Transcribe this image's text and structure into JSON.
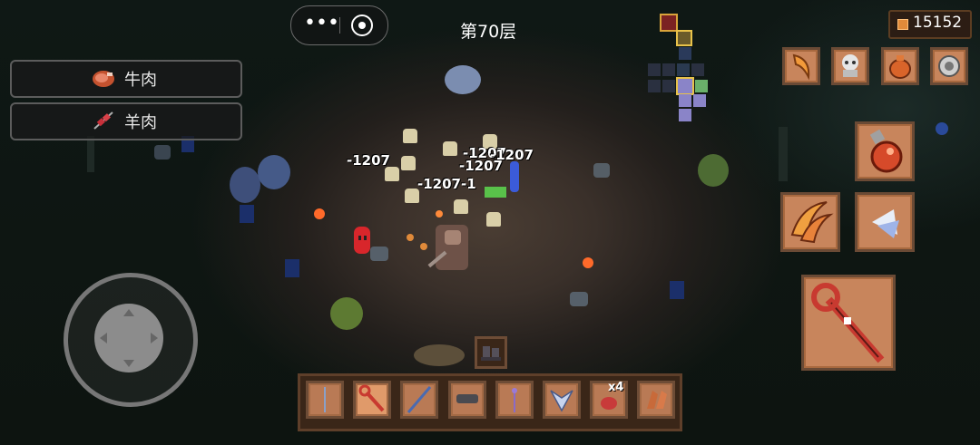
{
  "header": {
    "floor_label": "第70层",
    "coins": "15152"
  },
  "capsule": {
    "more_glyph": "•••",
    "close_glyph": "◉"
  },
  "food_list": [
    {
      "label": "牛肉",
      "icon": "steak-icon"
    },
    {
      "label": "羊肉",
      "icon": "mutton-skewer-icon"
    }
  ],
  "damage_numbers": [
    "-1207",
    "-1207",
    "-1207",
    "-1207-1",
    "-1207"
  ],
  "hotbar": {
    "bonus_badge": "x4",
    "slots": [
      "spear-icon",
      "fire-staff-icon",
      "lance-icon",
      "gauntlet-icon",
      "scepter-icon",
      "wings-icon",
      "meat-icon",
      "boomerang-icon"
    ]
  },
  "top_right_items": [
    "horn-icon",
    "skull-icon",
    "pouch-icon",
    "gear-relic-icon"
  ],
  "colors": {
    "accent_gold": "#e08a3a",
    "tile_fill": "#c8855c",
    "tile_border": "#6a4a35",
    "damage_text": "#ffffff"
  }
}
